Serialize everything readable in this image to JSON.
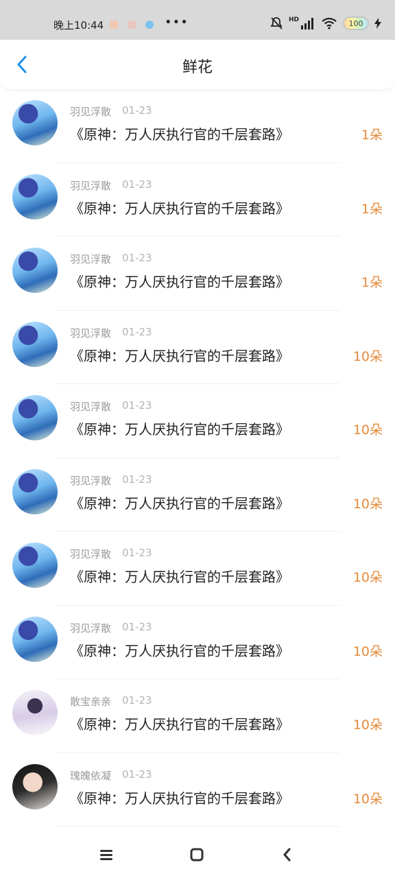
{
  "status_bar": {
    "time": "晚上10:44",
    "more": "•••",
    "network": "HD",
    "battery": "100"
  },
  "header": {
    "title": "鲜花"
  },
  "flowers": [
    {
      "user": "羽见浮散",
      "date": "01-23",
      "title": "《原神：万人厌执行官的千层套路》",
      "amount": "1朵",
      "avatar": "blue"
    },
    {
      "user": "羽见浮散",
      "date": "01-23",
      "title": "《原神：万人厌执行官的千层套路》",
      "amount": "1朵",
      "avatar": "blue"
    },
    {
      "user": "羽见浮散",
      "date": "01-23",
      "title": "《原神：万人厌执行官的千层套路》",
      "amount": "1朵",
      "avatar": "blue"
    },
    {
      "user": "羽见浮散",
      "date": "01-23",
      "title": "《原神：万人厌执行官的千层套路》",
      "amount": "10朵",
      "avatar": "blue"
    },
    {
      "user": "羽见浮散",
      "date": "01-23",
      "title": "《原神：万人厌执行官的千层套路》",
      "amount": "10朵",
      "avatar": "blue"
    },
    {
      "user": "羽见浮散",
      "date": "01-23",
      "title": "《原神：万人厌执行官的千层套路》",
      "amount": "10朵",
      "avatar": "blue"
    },
    {
      "user": "羽见浮散",
      "date": "01-23",
      "title": "《原神：万人厌执行官的千层套路》",
      "amount": "10朵",
      "avatar": "blue"
    },
    {
      "user": "羽见浮散",
      "date": "01-23",
      "title": "《原神：万人厌执行官的千层套路》",
      "amount": "10朵",
      "avatar": "blue"
    },
    {
      "user": "散宝亲亲",
      "date": "01-23",
      "title": "《原神：万人厌执行官的千层套路》",
      "amount": "10朵",
      "avatar": "lavender"
    },
    {
      "user": "瑰魄依凝",
      "date": "01-23",
      "title": "《原神：万人厌执行官的千层套路》",
      "amount": "10朵",
      "avatar": "dark"
    }
  ],
  "colors": {
    "accent": "#1e90e8",
    "amount": "#e58a3a",
    "meta": "#9a9a9a"
  },
  "icons": {
    "back": "chevron-left-icon",
    "menu": "menu-icon",
    "home": "home-icon",
    "nav_back": "back-icon"
  }
}
